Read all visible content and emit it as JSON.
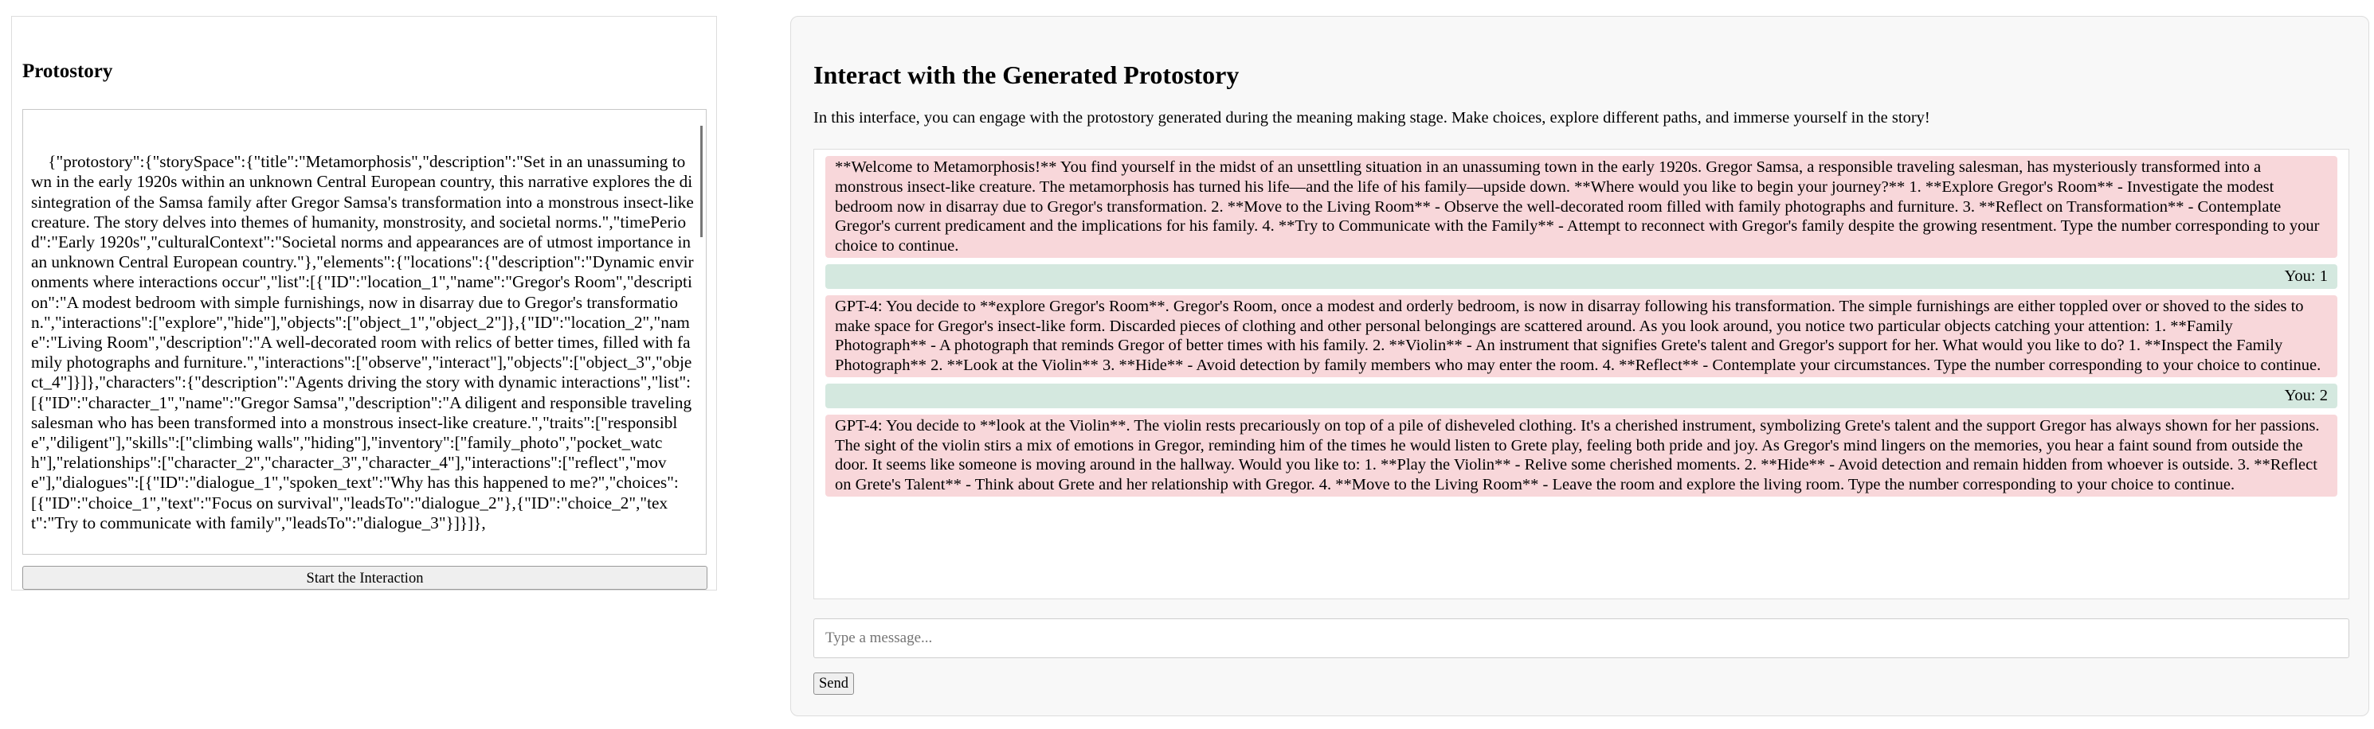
{
  "left": {
    "title": "Protostory",
    "json_text": "{\"protostory\":{\"storySpace\":{\"title\":\"Metamorphosis\",\"description\":\"Set in an unassuming town in the early 1920s within an unknown Central European country, this narrative explores the disintegration of the Samsa family after Gregor Samsa's transformation into a monstrous insect-like creature. The story delves into themes of humanity, monstrosity, and societal norms.\",\"timePeriod\":\"Early 1920s\",\"culturalContext\":\"Societal norms and appearances are of utmost importance in an unknown Central European country.\"},\"elements\":{\"locations\":{\"description\":\"Dynamic environments where interactions occur\",\"list\":[{\"ID\":\"location_1\",\"name\":\"Gregor's Room\",\"description\":\"A modest bedroom with simple furnishings, now in disarray due to Gregor's transformation.\",\"interactions\":[\"explore\",\"hide\"],\"objects\":[\"object_1\",\"object_2\"]},{\"ID\":\"location_2\",\"name\":\"Living Room\",\"description\":\"A well-decorated room with relics of better times, filled with family photographs and furniture.\",\"interactions\":[\"observe\",\"interact\"],\"objects\":[\"object_3\",\"object_4\"]}]},\"characters\":{\"description\":\"Agents driving the story with dynamic interactions\",\"list\":[{\"ID\":\"character_1\",\"name\":\"Gregor Samsa\",\"description\":\"A diligent and responsible traveling salesman who has been transformed into a monstrous insect-like creature.\",\"traits\":[\"responsible\",\"diligent\"],\"skills\":[\"climbing walls\",\"hiding\"],\"inventory\":[\"family_photo\",\"pocket_watch\"],\"relationships\":[\"character_2\",\"character_3\",\"character_4\"],\"interactions\":[\"reflect\",\"move\"],\"dialogues\":[{\"ID\":\"dialogue_1\",\"spoken_text\":\"Why has this happened to me?\",\"choices\":[{\"ID\":\"choice_1\",\"text\":\"Focus on survival\",\"leadsTo\":\"dialogue_2\"},{\"ID\":\"choice_2\",\"text\":\"Try to communicate with family\",\"leadsTo\":\"dialogue_3\"}]}]},",
    "start_button_label": "Start the Interaction"
  },
  "right": {
    "title": "Interact with the Generated Protostory",
    "intro": "In this interface, you can engage with the protostory generated during the meaning making stage. Make choices, explore different paths, and immerse yourself in the story!",
    "messages": [
      {
        "role": "bot",
        "text": "**Welcome to Metamorphosis!** You find yourself in the midst of an unsettling situation in an unassuming town in the early 1920s. Gregor Samsa, a responsible traveling salesman, has mysteriously transformed into a monstrous insect-like creature. The metamorphosis has turned his life—and the life of his family—upside down. **Where would you like to begin your journey?** 1. **Explore Gregor's Room** - Investigate the modest bedroom now in disarray due to Gregor's transformation. 2. **Move to the Living Room** - Observe the well-decorated room filled with family photographs and furniture. 3. **Reflect on Transformation** - Contemplate Gregor's current predicament and the implications for his family. 4. **Try to Communicate with the Family** - Attempt to reconnect with Gregor's family despite the growing resentment. Type the number corresponding to your choice to continue."
      },
      {
        "role": "user",
        "text": "You: 1"
      },
      {
        "role": "bot",
        "text": "GPT-4: You decide to **explore Gregor's Room**. Gregor's Room, once a modest and orderly bedroom, is now in disarray following his transformation. The simple furnishings are either toppled over or shoved to the sides to make space for Gregor's insect-like form. Discarded pieces of clothing and other personal belongings are scattered around. As you look around, you notice two particular objects catching your attention: 1. **Family Photograph** - A photograph that reminds Gregor of better times with his family. 2. **Violin** - An instrument that signifies Grete's talent and Gregor's support for her. What would you like to do? 1. **Inspect the Family Photograph** 2. **Look at the Violin** 3. **Hide** - Avoid detection by family members who may enter the room. 4. **Reflect** - Contemplate your circumstances. Type the number corresponding to your choice to continue."
      },
      {
        "role": "user",
        "text": "You: 2"
      },
      {
        "role": "bot",
        "text": "GPT-4: You decide to **look at the Violin**. The violin rests precariously on top of a pile of disheveled clothing. It's a cherished instrument, symbolizing Grete's talent and the support Gregor has always shown for her passions. The sight of the violin stirs a mix of emotions in Gregor, reminding him of the times he would listen to Grete play, feeling both pride and joy. As Gregor's mind lingers on the memories, you hear a faint sound from outside the door. It seems like someone is moving around in the hallway. Would you like to: 1. **Play the Violin** - Relive some cherished moments. 2. **Hide** - Avoid detection and remain hidden from whoever is outside. 3. **Reflect on Grete's Talent** - Think about Grete and her relationship with Gregor. 4. **Move to the Living Room** - Leave the room and explore the living room. Type the number corresponding to your choice to continue."
      }
    ],
    "input_placeholder": "Type a message...",
    "send_label": "Send"
  },
  "colors": {
    "bot_bubble": "#f8d7da",
    "user_bubble": "#d4e8df"
  }
}
